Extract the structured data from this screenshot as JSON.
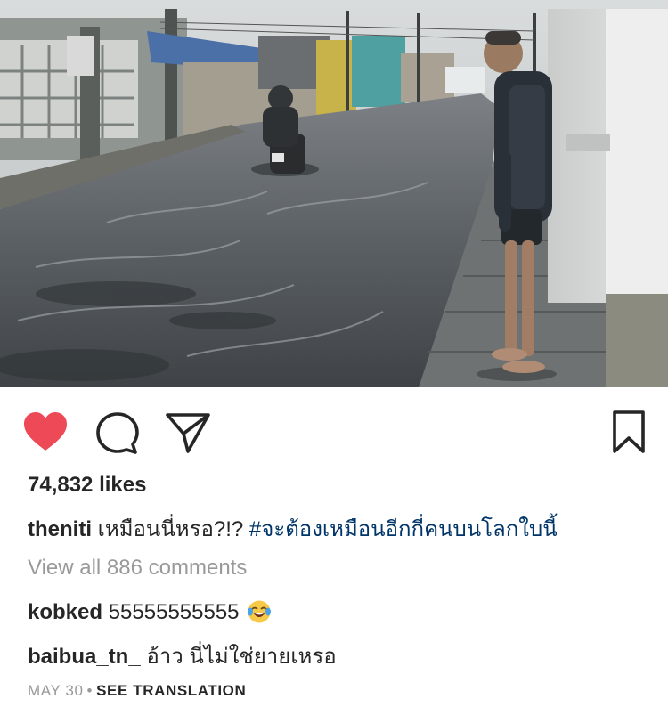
{
  "post": {
    "likes_text": "74,832 likes",
    "caption": {
      "username": "theniti",
      "text": "เหมือนนี่หรอ?!?",
      "hashtag": "#จะต้องเหมือนอีกกี่คนบนโลกใบนี้"
    },
    "view_all_comments": "View all 886 comments",
    "comments": [
      {
        "username": "kobked",
        "text": "55555555555",
        "emoji": "face-with-tears-of-joy"
      },
      {
        "username": "baibua_tn_",
        "text": "อ้าว นี่ไม่ใช่ยายเหรอ"
      }
    ],
    "date": "MAY 30",
    "separator": "•",
    "see_translation": "SEE TRANSLATION"
  },
  "icons": {
    "like": "heart-icon",
    "comment": "comment-bubble-icon",
    "share": "paper-plane-icon",
    "save": "bookmark-icon"
  },
  "colors": {
    "heart": "#ed4956",
    "hashtag": "#003569",
    "muted": "#999999",
    "text": "#262626"
  }
}
